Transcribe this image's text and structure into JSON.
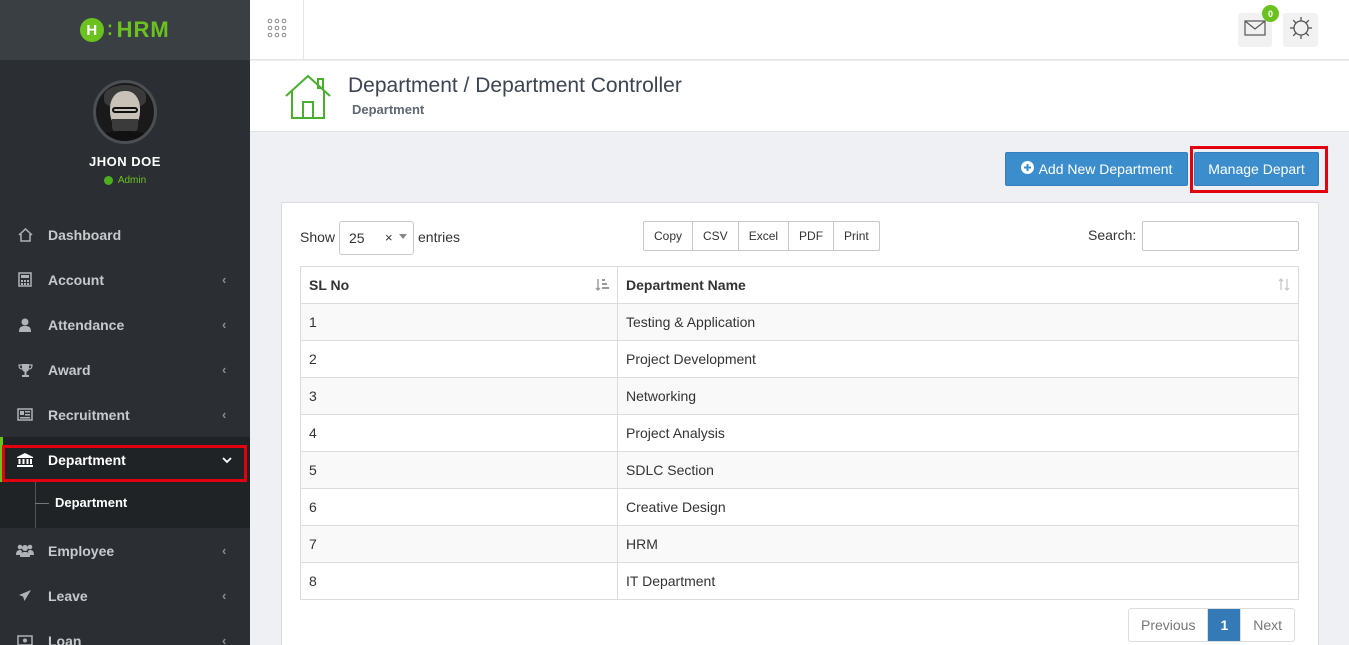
{
  "app": {
    "logo_text": "HRM",
    "logo_letter": "H"
  },
  "user": {
    "name": "JHON DOE",
    "role": "Admin"
  },
  "sidebar": {
    "items": [
      {
        "label": "Dashboard",
        "icon": "home-icon"
      },
      {
        "label": "Account",
        "icon": "calculator-icon"
      },
      {
        "label": "Attendance",
        "icon": "user-icon"
      },
      {
        "label": "Award",
        "icon": "trophy-icon"
      },
      {
        "label": "Recruitment",
        "icon": "newspaper-icon"
      },
      {
        "label": "Department",
        "icon": "bank-icon",
        "active": true
      },
      {
        "label": "Employee",
        "icon": "users-icon"
      },
      {
        "label": "Leave",
        "icon": "plane-icon"
      },
      {
        "label": "Loan",
        "icon": "money-icon"
      }
    ],
    "submenu": {
      "label": "Department"
    }
  },
  "topbar": {
    "mail_badge": "0"
  },
  "header": {
    "title": "Department / Department Controller",
    "subtitle": "Department"
  },
  "actions": {
    "add_label": "Add New Department",
    "manage_label": "Manage Depart"
  },
  "table_controls": {
    "show_label": "Show",
    "entries_value": "25",
    "entries_label": "entries",
    "export_buttons": [
      "Copy",
      "CSV",
      "Excel",
      "PDF",
      "Print"
    ],
    "search_label": "Search:",
    "search_value": ""
  },
  "table": {
    "headers": [
      "SL No",
      "Department Name"
    ],
    "rows": [
      [
        "1",
        "Testing & Application"
      ],
      [
        "2",
        "Project Development"
      ],
      [
        "3",
        "Networking"
      ],
      [
        "4",
        "Project Analysis"
      ],
      [
        "5",
        "SDLC Section"
      ],
      [
        "6",
        "Creative Design"
      ],
      [
        "7",
        "HRM"
      ],
      [
        "8",
        "IT Department"
      ]
    ]
  },
  "pagination": {
    "previous": "Previous",
    "current": "1",
    "next": "Next"
  },
  "colors": {
    "accent": "#6bc21f",
    "primary": "#3c8dcb",
    "highlight": "#e3000f",
    "sidebar": "#2b2f33"
  }
}
